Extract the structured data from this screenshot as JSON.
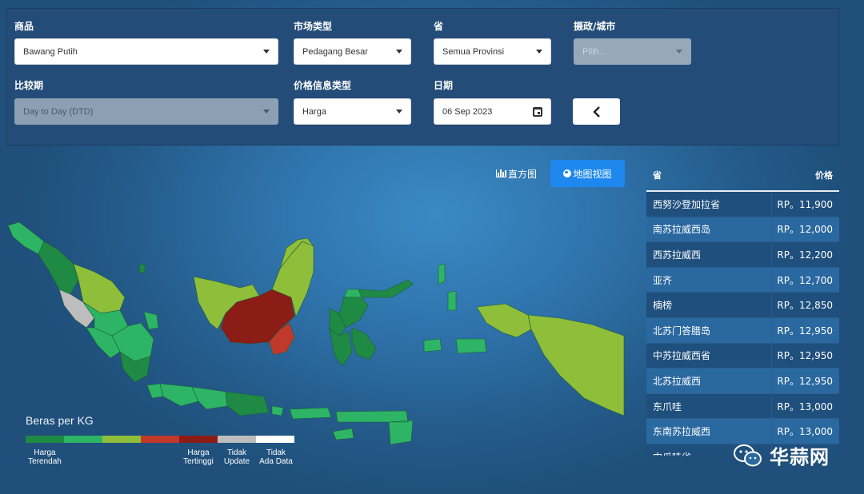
{
  "filters": {
    "commodity": {
      "label": "商品",
      "value": "Bawang Putih"
    },
    "market_type": {
      "label": "市场类型",
      "value": "Pedagang Besar"
    },
    "province": {
      "label": "省",
      "value": "Semua Provinsi"
    },
    "regency": {
      "label": "摄政/城市",
      "placeholder": "Pilih..."
    },
    "comparison": {
      "label": "比较期",
      "value": "Day to Day (DTD)"
    },
    "price_type": {
      "label": "价格信息类型",
      "value": "Harga"
    },
    "date": {
      "label": "日期",
      "value": "06 Sep 2023"
    },
    "back_icon": "chevron-left-icon"
  },
  "view_toggle": {
    "histogram": "直方图",
    "map": "地图视图"
  },
  "legend": {
    "title": "Beras per KG",
    "colors": [
      "#1e8a44",
      "#2db565",
      "#8fbe3a",
      "#c0392b",
      "#8b1c16",
      "#bdbdbd",
      "#ffffff"
    ],
    "labels": [
      {
        "line1": "Harga",
        "line2": "Terendah"
      },
      {
        "line1": "Harga",
        "line2": "Tertinggi"
      },
      {
        "line1": "Tidak",
        "line2": "Update"
      },
      {
        "line1": "Tidak",
        "line2": "Ada Data"
      }
    ]
  },
  "price_table": {
    "header": {
      "province": "省",
      "price": "价格"
    },
    "rows": [
      {
        "province": "西努沙登加拉省",
        "price": "RP。11,900"
      },
      {
        "province": "南苏拉威西岛",
        "price": "RP。12,000"
      },
      {
        "province": "西苏拉威西",
        "price": "RP。12,200"
      },
      {
        "province": "亚齐",
        "price": "RP。12,700"
      },
      {
        "province": "楠榜",
        "price": "RP。12,850"
      },
      {
        "province": "北苏门答腊岛",
        "price": "RP。12,950"
      },
      {
        "province": "中苏拉威西省",
        "price": "RP。12,950"
      },
      {
        "province": "北苏拉威西",
        "price": "RP。12,950"
      },
      {
        "province": "东爪哇",
        "price": "RP。13,000"
      },
      {
        "province": "东南苏拉威西",
        "price": "RP。13,000"
      },
      {
        "province": "中爪哇省",
        "price": ""
      }
    ]
  },
  "watermark": {
    "text": "华蒜网"
  }
}
